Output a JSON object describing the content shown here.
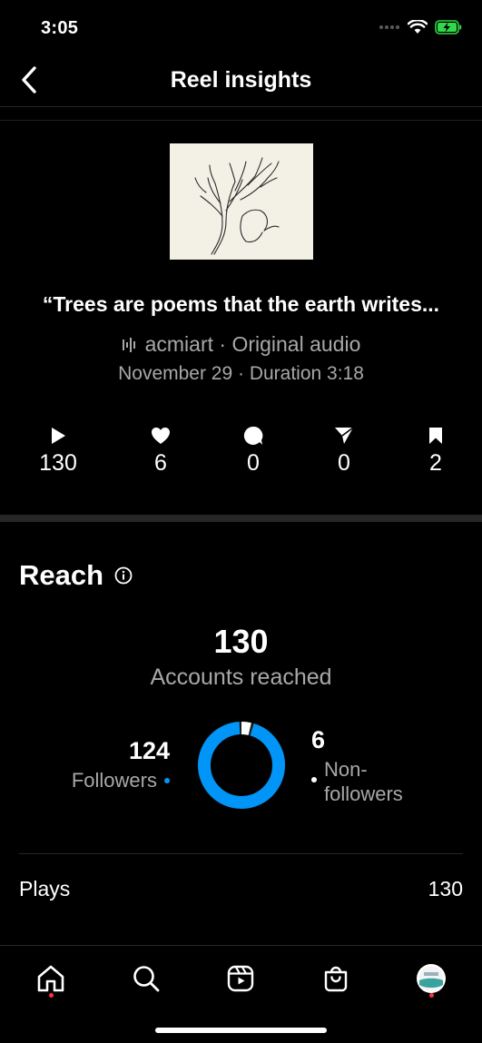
{
  "status_bar": {
    "time": "3:05"
  },
  "header": {
    "title": "Reel insights"
  },
  "reel": {
    "caption": "“Trees are poems that the earth writes...",
    "audio": "acmiart · Original audio",
    "date": "November 29 · Duration 3:18"
  },
  "stats": [
    {
      "icon": "play-icon",
      "value": "130"
    },
    {
      "icon": "heart-icon",
      "value": "6"
    },
    {
      "icon": "comment-icon",
      "value": "0"
    },
    {
      "icon": "share-icon",
      "value": "0"
    },
    {
      "icon": "bookmark-icon",
      "value": "2"
    }
  ],
  "reach": {
    "title": "Reach",
    "total": "130",
    "total_label": "Accounts reached",
    "followers_value": "124",
    "followers_label": "Followers",
    "nonfollowers_value": "6",
    "nonfollowers_label": "Non-followers",
    "followers_fraction": 0.954
  },
  "plays": {
    "label": "Plays",
    "value": "130"
  },
  "tabs": [
    "home-icon",
    "search-icon",
    "reels-icon",
    "shop-icon",
    "profile-avatar"
  ],
  "colors": {
    "accent": "#0095f6",
    "notification_dot": "#ff3040",
    "secondary_text": "#a8a8a8"
  }
}
